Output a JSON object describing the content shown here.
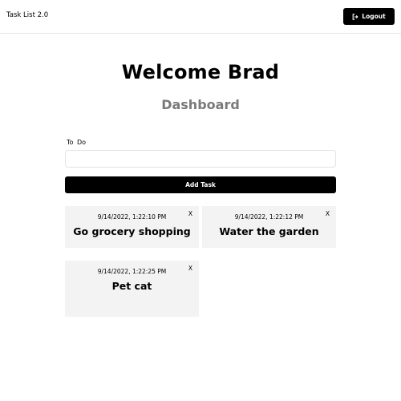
{
  "header": {
    "title": "Task List 2.0",
    "logout_label": "Logout",
    "logout_icon": "logout-icon"
  },
  "main": {
    "welcome": "Welcome Brad",
    "subtitle": "Dashboard",
    "todo_label": "To Do",
    "todo_value": "",
    "add_label": "Add Task"
  },
  "tasks": [
    {
      "timestamp": "9/14/2022, 1:22:10 PM",
      "title": "Go grocery shopping",
      "delete_label": "X"
    },
    {
      "timestamp": "9/14/2022, 1:22:12 PM",
      "title": "Water the garden",
      "delete_label": "X"
    },
    {
      "timestamp": "9/14/2022, 1:22:25 PM",
      "title": "Pet cat",
      "delete_label": "X"
    }
  ]
}
